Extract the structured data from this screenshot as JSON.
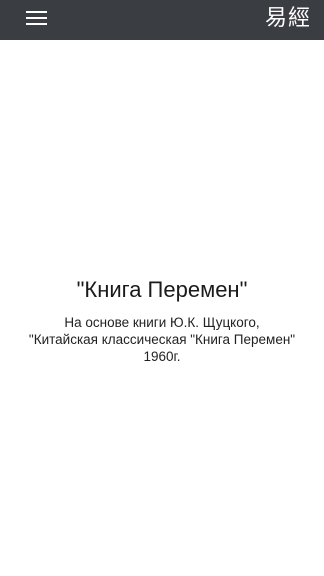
{
  "header": {
    "logo_text": "易經",
    "menu_icon": "hamburger-menu-icon",
    "background_color": "#3a3d42"
  },
  "main": {
    "title": "\"Книга Перемен\"",
    "subtitle_lines": [
      "На основе книги Ю.К. Щуцкого,",
      "\"Китайская классическая \"Книга Перемен\"",
      "1960г."
    ]
  }
}
